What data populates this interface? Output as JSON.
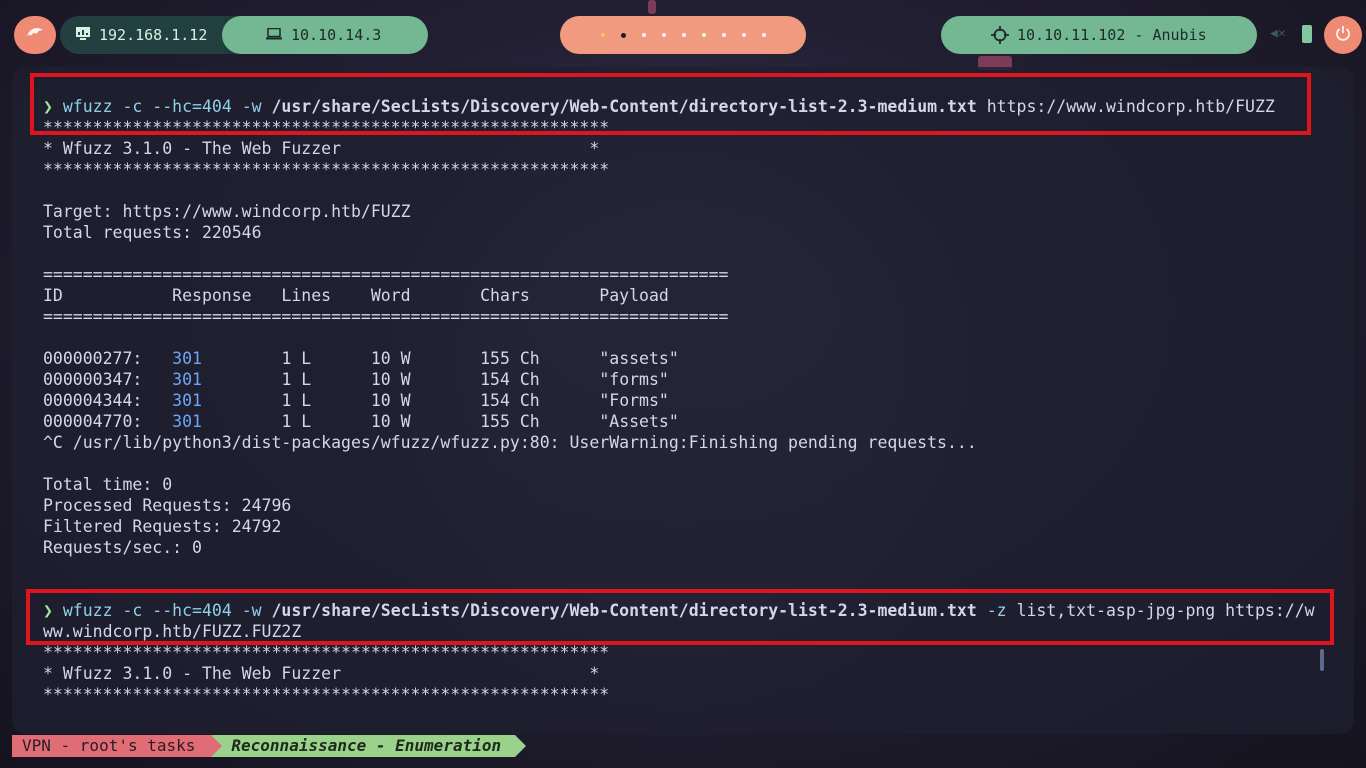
{
  "topbar": {
    "local_ip": "192.168.1.12",
    "vpn_ip": "10.10.14.3",
    "target": "10.10.11.102 - Anubis",
    "workspaces": 9,
    "active_workspace": 2
  },
  "colors": {
    "highlight": "#e0141c",
    "prompt": "#9ee69a",
    "status_code": "#6ba7f5",
    "vpn_segment": "#e06c75",
    "task_segment": "#9ad18b"
  },
  "terminal": {
    "cmd1": {
      "prompt": "❯",
      "program": "wfuzz",
      "options": "-c --hc=404 -w",
      "wordlist": "/usr/share/SecLists/Discovery/Web-Content/directory-list-2.3-medium.txt",
      "url": "https://www.windcorp.htb/FUZZ"
    },
    "banner_stars": "*********************************************************",
    "banner_title": "* Wfuzz 3.1.0 - The Web Fuzzer                         *",
    "target_line": "Target: https://www.windcorp.htb/FUZZ",
    "total_requests_line": "Total requests: 220546",
    "separator": "=====================================================================",
    "header_line": "ID           Response   Lines    Word       Chars       Payload",
    "results": [
      {
        "id": "000000277:",
        "code": "301",
        "rest": "        1 L      10 W       155 Ch      \"assets\""
      },
      {
        "id": "000000347:",
        "code": "301",
        "rest": "        1 L      10 W       154 Ch      \"forms\""
      },
      {
        "id": "000004344:",
        "code": "301",
        "rest": "        1 L      10 W       154 Ch      \"Forms\""
      },
      {
        "id": "000004770:",
        "code": "301",
        "rest": "        1 L      10 W       155 Ch      \"Assets\""
      }
    ],
    "interrupt_line": "^C /usr/lib/python3/dist-packages/wfuzz/wfuzz.py:80: UserWarning:Finishing pending requests...",
    "total_time": "Total time: 0",
    "processed": "Processed Requests: 24796",
    "filtered": "Filtered Requests: 24792",
    "rate": "Requests/sec.: 0",
    "cmd2": {
      "prompt": "❯",
      "program": "wfuzz",
      "options": "-c --hc=404 -w",
      "wordlist": "/usr/share/SecLists/Discovery/Web-Content/directory-list-2.3-medium.txt",
      "opt2": "-z",
      "arg2": "list,txt-asp-jpg-png https://w",
      "wrap": "ww.windcorp.htb/FUZZ.FUZ2Z"
    }
  },
  "statusbar": {
    "vpn": "VPN - root's tasks",
    "task": "Reconnaissance - Enumeration"
  }
}
